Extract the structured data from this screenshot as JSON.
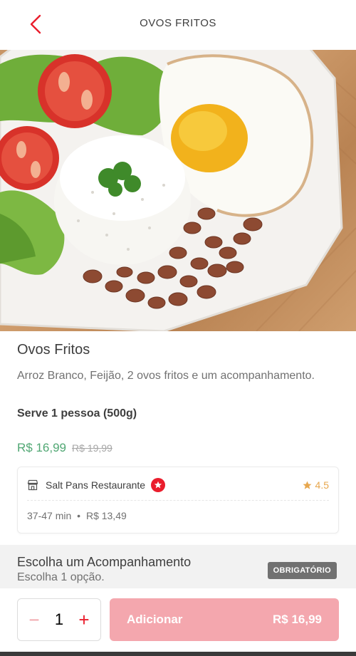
{
  "header": {
    "title": "OVOS FRITOS"
  },
  "item": {
    "name": "Ovos Fritos",
    "description": "Arroz Branco, Feijão, 2 ovos fritos e um acompanhamento.",
    "serves": "Serve 1 pessoa (500g)",
    "price": "R$ 16,99",
    "old_price": "R$ 19,99"
  },
  "restaurant": {
    "name": "Salt Pans Restaurante",
    "rating": "4.5",
    "delivery_time": "37-47 min",
    "separator": "•",
    "delivery_fee": "R$ 13,49"
  },
  "options_section": {
    "title": "Escolha um Acompanhamento",
    "subtitle": "Escolha 1 opção.",
    "badge": "OBRIGATÓRIO"
  },
  "footer": {
    "quantity": "1",
    "minus": "−",
    "plus": "+",
    "add_label": "Adicionar",
    "total": "R$ 16,99"
  },
  "icons": {
    "back": "chevron-left-icon",
    "store": "store-icon",
    "super_badge": "super-restaurant-icon",
    "star": "star-icon"
  },
  "colors": {
    "brand_red": "#ea1d2c",
    "price_green": "#50a773",
    "rating_gold": "#e7a74e",
    "add_button": "#f4a7ae",
    "badge_gray": "#717171"
  }
}
